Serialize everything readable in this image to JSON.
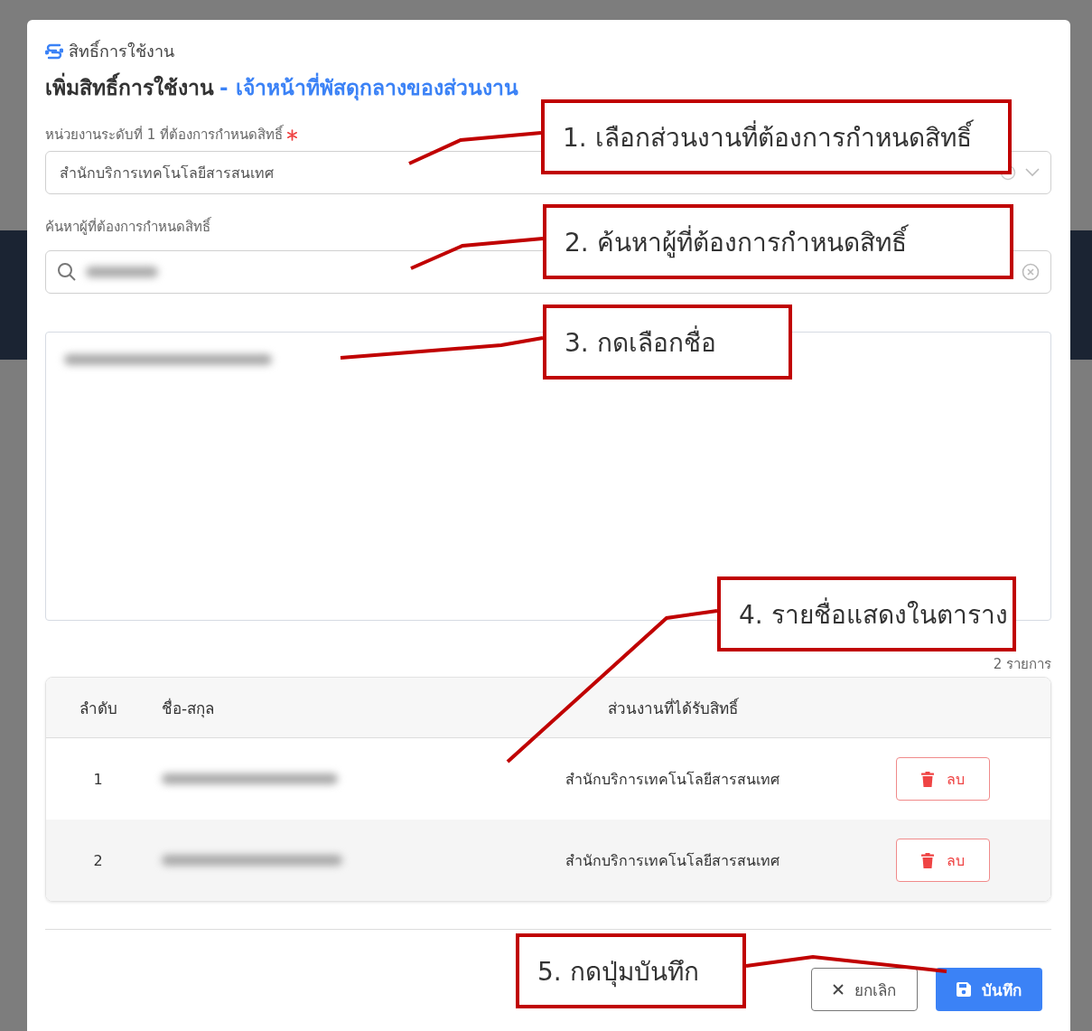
{
  "modal": {
    "breadcrumb": "สิทธิ์การใช้งาน",
    "title": "เพิ่มสิทธิ์การใช้งาน",
    "subtitle": "- เจ้าหน้าที่พัสดุกลางของส่วนงาน"
  },
  "department_field": {
    "label": "หน่วยงานระดับที่ 1 ที่ต้องการกำหนดสิทธิ์",
    "required": true,
    "value": "สำนักบริการเทคโนโลยีสารสนเทศ"
  },
  "search_field": {
    "label": "ค้นหาผู้ที่ต้องการกำหนดสิทธิ์"
  },
  "record_count": "2 รายการ",
  "table": {
    "columns": [
      "ลำดับ",
      "ชื่อ-สกุล",
      "ส่วนงานที่ได้รับสิทธิ์"
    ],
    "rows": [
      {
        "index": "1",
        "department": "สำนักบริการเทคโนโลยีสารสนเทศ",
        "action": "ลบ"
      },
      {
        "index": "2",
        "department": "สำนักบริการเทคโนโลยีสารสนเทศ",
        "action": "ลบ"
      }
    ]
  },
  "buttons": {
    "cancel": "ยกเลิก",
    "save": "บันทึก"
  },
  "callouts": [
    {
      "text": "1. เลือกส่วนงานที่ต้องการกำหนดสิทธิ์"
    },
    {
      "text": "2. ค้นหาผู้ที่ต้องการกำหนดสิทธิ์"
    },
    {
      "text": "3. กดเลือกชื่อ"
    },
    {
      "text": "4. รายชื่อแสดงในตาราง"
    },
    {
      "text": "5. กดปุ่มบันทึก"
    }
  ]
}
